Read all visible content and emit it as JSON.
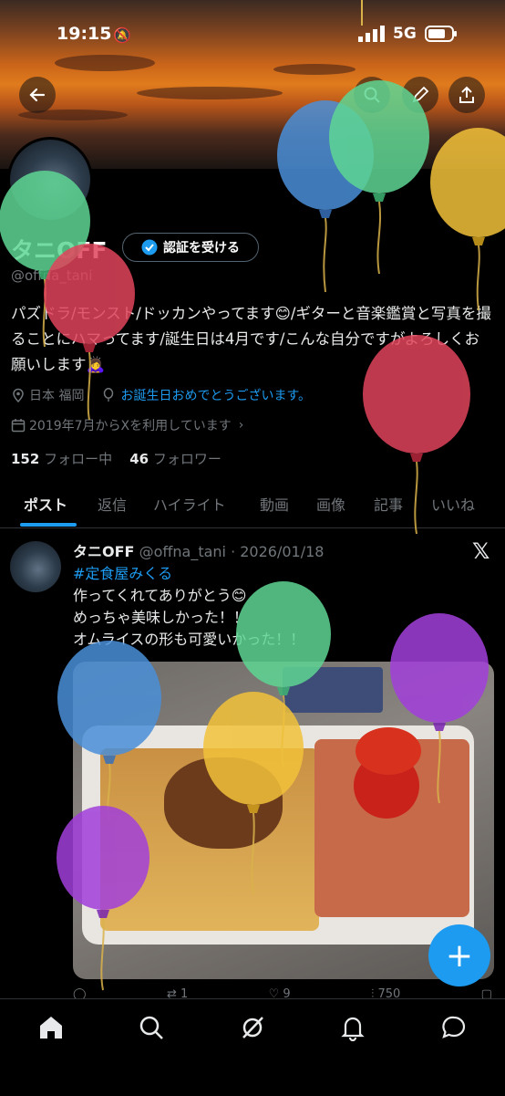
{
  "status": {
    "time": "19:15",
    "network": "5G"
  },
  "profile": {
    "name": "タニOFF",
    "verify_label": "認証を受ける",
    "handle": "@offna_tani",
    "bio": "パズドラ/モンスト/ドッカンやってます😊/ギターと音楽鑑賞と写真を撮ることにハマってます/誕生日は4月です/こんな自分ですがよろしくお願いします🙇‍♀️",
    "location": "日本 福岡",
    "birthday_text": "お誕生日おめでとうございます。",
    "joined": "2019年7月からXを利用しています",
    "following_count": "152",
    "following_label": "フォロー中",
    "followers_count": "46",
    "followers_label": "フォロワー"
  },
  "tabs": [
    "ポスト",
    "返信",
    "ハイライト",
    "動画",
    "画像",
    "記事",
    "いいね"
  ],
  "post": {
    "author": "タニOFF",
    "handle_date": "@offna_tani · 2026/01/18",
    "hashtag": "#定食屋みくる",
    "lines": [
      "作ってくれてありがとう😊",
      "めっちゃ美味しかった！！",
      "オムライスの形も可愛いかった！！"
    ],
    "actions": [
      "",
      "1",
      "9",
      "750",
      ""
    ]
  },
  "icons": {
    "back": "arrow-left-icon",
    "search": "search-icon",
    "edit": "pencil-icon",
    "share": "share-icon",
    "nav": [
      "home-icon",
      "search-icon",
      "grok-icon",
      "bell-icon",
      "message-icon"
    ],
    "fab": "plus-icon"
  },
  "colors": {
    "accent": "#1d9bf0",
    "background": "#000000",
    "muted": "#71767b"
  }
}
